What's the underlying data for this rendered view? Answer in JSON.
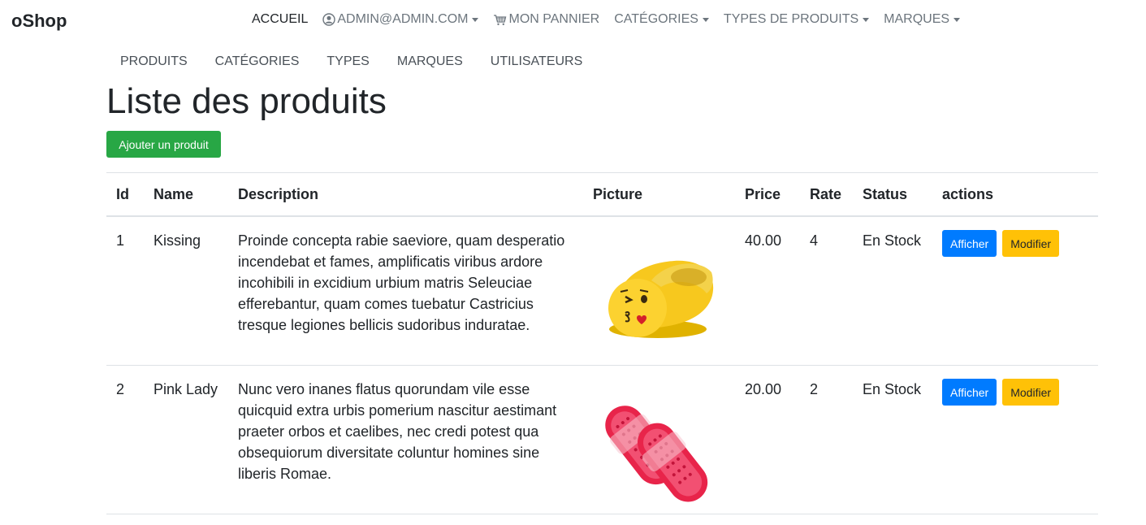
{
  "brand": "oShop",
  "topnav": {
    "home": "ACCUEIL",
    "user": "ADMIN@ADMIN.COM",
    "cart": "MON PANNIER",
    "categories": "CATÉGORIES",
    "product_types": "TYPES DE PRODUITS",
    "brands": "MARQUES"
  },
  "subnav": {
    "products": "PRODUITS",
    "categories": "CATÉGORIES",
    "types": "TYPES",
    "brands": "MARQUES",
    "users": "UTILISATEURS"
  },
  "page_title": "Liste des produits",
  "add_button": "Ajouter un produit",
  "table": {
    "headers": [
      "Id",
      "Name",
      "Description",
      "Picture",
      "Price",
      "Rate",
      "Status",
      "actions"
    ],
    "rows": [
      {
        "id": "1",
        "name": "Kissing",
        "description": "Proinde concepta rabie saeviore, quam desperatio incendebat et fames, amplificatis viribus ardore incohibili in excidium urbium matris Seleuciae efferebantur, quam comes tuebatur Castricius tresque legiones bellicis sudoribus induratae.",
        "picture": "yellow-kissing-emoji-slipper",
        "price": "40.00",
        "rate": "4",
        "status": "En Stock",
        "show_label": "Afficher",
        "edit_label": "Modifier"
      },
      {
        "id": "2",
        "name": "Pink Lady",
        "description": "Nunc vero inanes flatus quorundam vile esse quicquid extra urbis pomerium nascitur aestimant praeter orbos et caelibes, nec credi potest qua obsequiorum diversitate coluntur homines sine liberis Romae.",
        "picture": "pink-jelly-sandals",
        "price": "20.00",
        "rate": "2",
        "status": "En Stock",
        "show_label": "Afficher",
        "edit_label": "Modifier"
      }
    ]
  },
  "colors": {
    "success": "#28a745",
    "primary": "#007bff",
    "warning": "#ffc107",
    "text": "#212529",
    "muted": "#6c757d"
  }
}
